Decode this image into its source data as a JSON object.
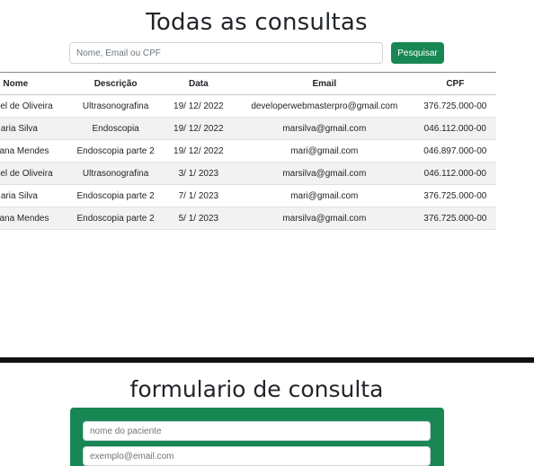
{
  "header": {
    "title": "Todas as consultas"
  },
  "search": {
    "placeholder": "Nome, Email ou CPF",
    "value": "",
    "button_label": "Pesquisar"
  },
  "table": {
    "columns": [
      "Nome",
      "Descrição",
      "Data",
      "Email",
      "CPF"
    ],
    "rows": [
      {
        "name": "Gabriel de Oliveira",
        "desc": "Ultrasonografina",
        "date": "19/ 12/ 2022",
        "email": "developerwebmasterpro@gmail.com",
        "cpf": "376.725.000-00"
      },
      {
        "name": "Maria Silva",
        "desc": "Endoscopia",
        "date": "19/ 12/ 2022",
        "email": "marsilva@gmail.com",
        "cpf": "046.112.000-00"
      },
      {
        "name": "Mariana Mendes",
        "desc": "Endoscopia parte 2",
        "date": "19/ 12/ 2022",
        "email": "mari@gmail.com",
        "cpf": "046.897.000-00"
      },
      {
        "name": "Gabriel de Oliveira",
        "desc": "Ultrasonografina",
        "date": "3/ 1/ 2023",
        "email": "marsilva@gmail.com",
        "cpf": "046.112.000-00"
      },
      {
        "name": "Maria Silva",
        "desc": "Endoscopia parte 2",
        "date": "7/ 1/ 2023",
        "email": "mari@gmail.com",
        "cpf": "376.725.000-00"
      },
      {
        "name": "Mariana Mendes",
        "desc": "Endoscopia parte 2",
        "date": "5/ 1/ 2023",
        "email": "marsilva@gmail.com",
        "cpf": "376.725.000-00"
      }
    ]
  },
  "form": {
    "title": "formulario de consulta",
    "name_placeholder": "nome do paciente",
    "email_placeholder": "exemplo@email.com"
  },
  "colors": {
    "accent": "#198754",
    "divider": "#111111",
    "row_alt": "#f2f2f2"
  }
}
